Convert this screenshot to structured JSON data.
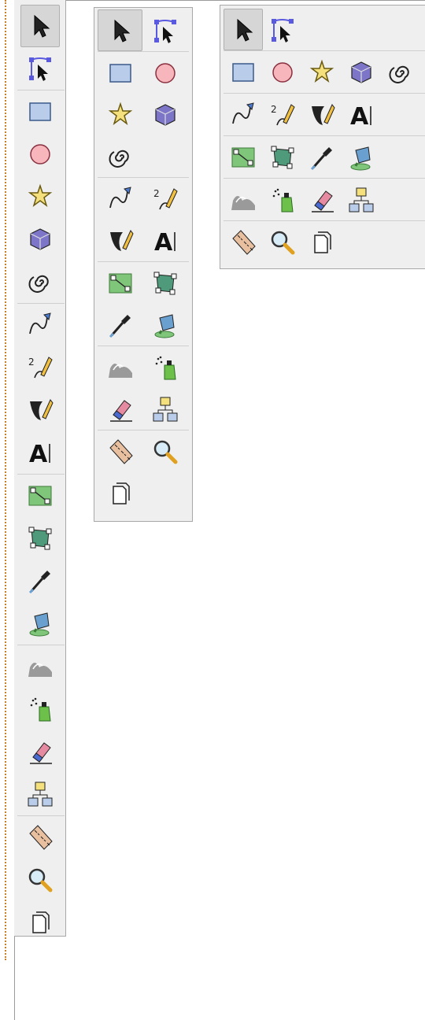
{
  "toolboxes": [
    {
      "name": "vertical",
      "groups": [
        [
          "selector",
          "node"
        ],
        [
          "rect",
          "ellipse",
          "star",
          "box3d",
          "spiral"
        ],
        [
          "pencil",
          "pen",
          "calligraphy",
          "text"
        ],
        [
          "gradient",
          "mesh",
          "dropper",
          "paintbucket"
        ],
        [
          "tweak",
          "spray",
          "eraser",
          "connector"
        ],
        [
          "measure",
          "zoom",
          "pages"
        ]
      ]
    },
    {
      "name": "two-column",
      "groups": [
        [
          "selector",
          "node"
        ],
        [
          "rect",
          "ellipse",
          "star",
          "box3d",
          "spiral"
        ],
        [
          "pencil",
          "pen",
          "calligraphy",
          "text"
        ],
        [
          "gradient",
          "mesh",
          "dropper",
          "paintbucket"
        ],
        [
          "tweak",
          "spray",
          "eraser",
          "connector"
        ],
        [
          "measure",
          "zoom",
          "pages"
        ]
      ]
    },
    {
      "name": "wide",
      "groups": [
        [
          "selector",
          "node"
        ],
        [
          "rect",
          "ellipse",
          "star",
          "box3d",
          "spiral"
        ],
        [
          "pencil",
          "pen",
          "calligraphy",
          "text"
        ],
        [
          "gradient",
          "mesh",
          "dropper",
          "paintbucket"
        ],
        [
          "tweak",
          "spray",
          "eraser",
          "connector"
        ],
        [
          "measure",
          "zoom",
          "pages"
        ]
      ]
    }
  ],
  "icons": {
    "selector": "arrow-selector-icon",
    "node": "node-editor-icon",
    "rect": "rectangle-icon",
    "ellipse": "ellipse-icon",
    "star": "star-icon",
    "box3d": "3d-box-icon",
    "spiral": "spiral-icon",
    "pencil": "bezier-pen-icon",
    "pen": "pencil-icon",
    "calligraphy": "calligraphy-icon",
    "text": "text-icon",
    "gradient": "gradient-icon",
    "mesh": "mesh-icon",
    "dropper": "dropper-icon",
    "paintbucket": "paint-bucket-icon",
    "tweak": "tweak-icon",
    "spray": "spray-icon",
    "eraser": "eraser-icon",
    "connector": "connector-icon",
    "measure": "measure-icon",
    "zoom": "zoom-icon",
    "pages": "pages-icon"
  },
  "text_glyph": "A",
  "colors": {
    "panel_bg": "#efefef",
    "border": "#a8a8a8",
    "active_bg": "#d6d6d6",
    "node_blue": "#5a5ae0",
    "rect_blue": "#b9cdea",
    "ellipse_pink": "#f6b6bb",
    "star_yellow": "#f4e07c",
    "box3d_purple": "#7d76c8",
    "gradient_green": "#7fc67a",
    "mesh_teal": "#4e9a7a"
  }
}
